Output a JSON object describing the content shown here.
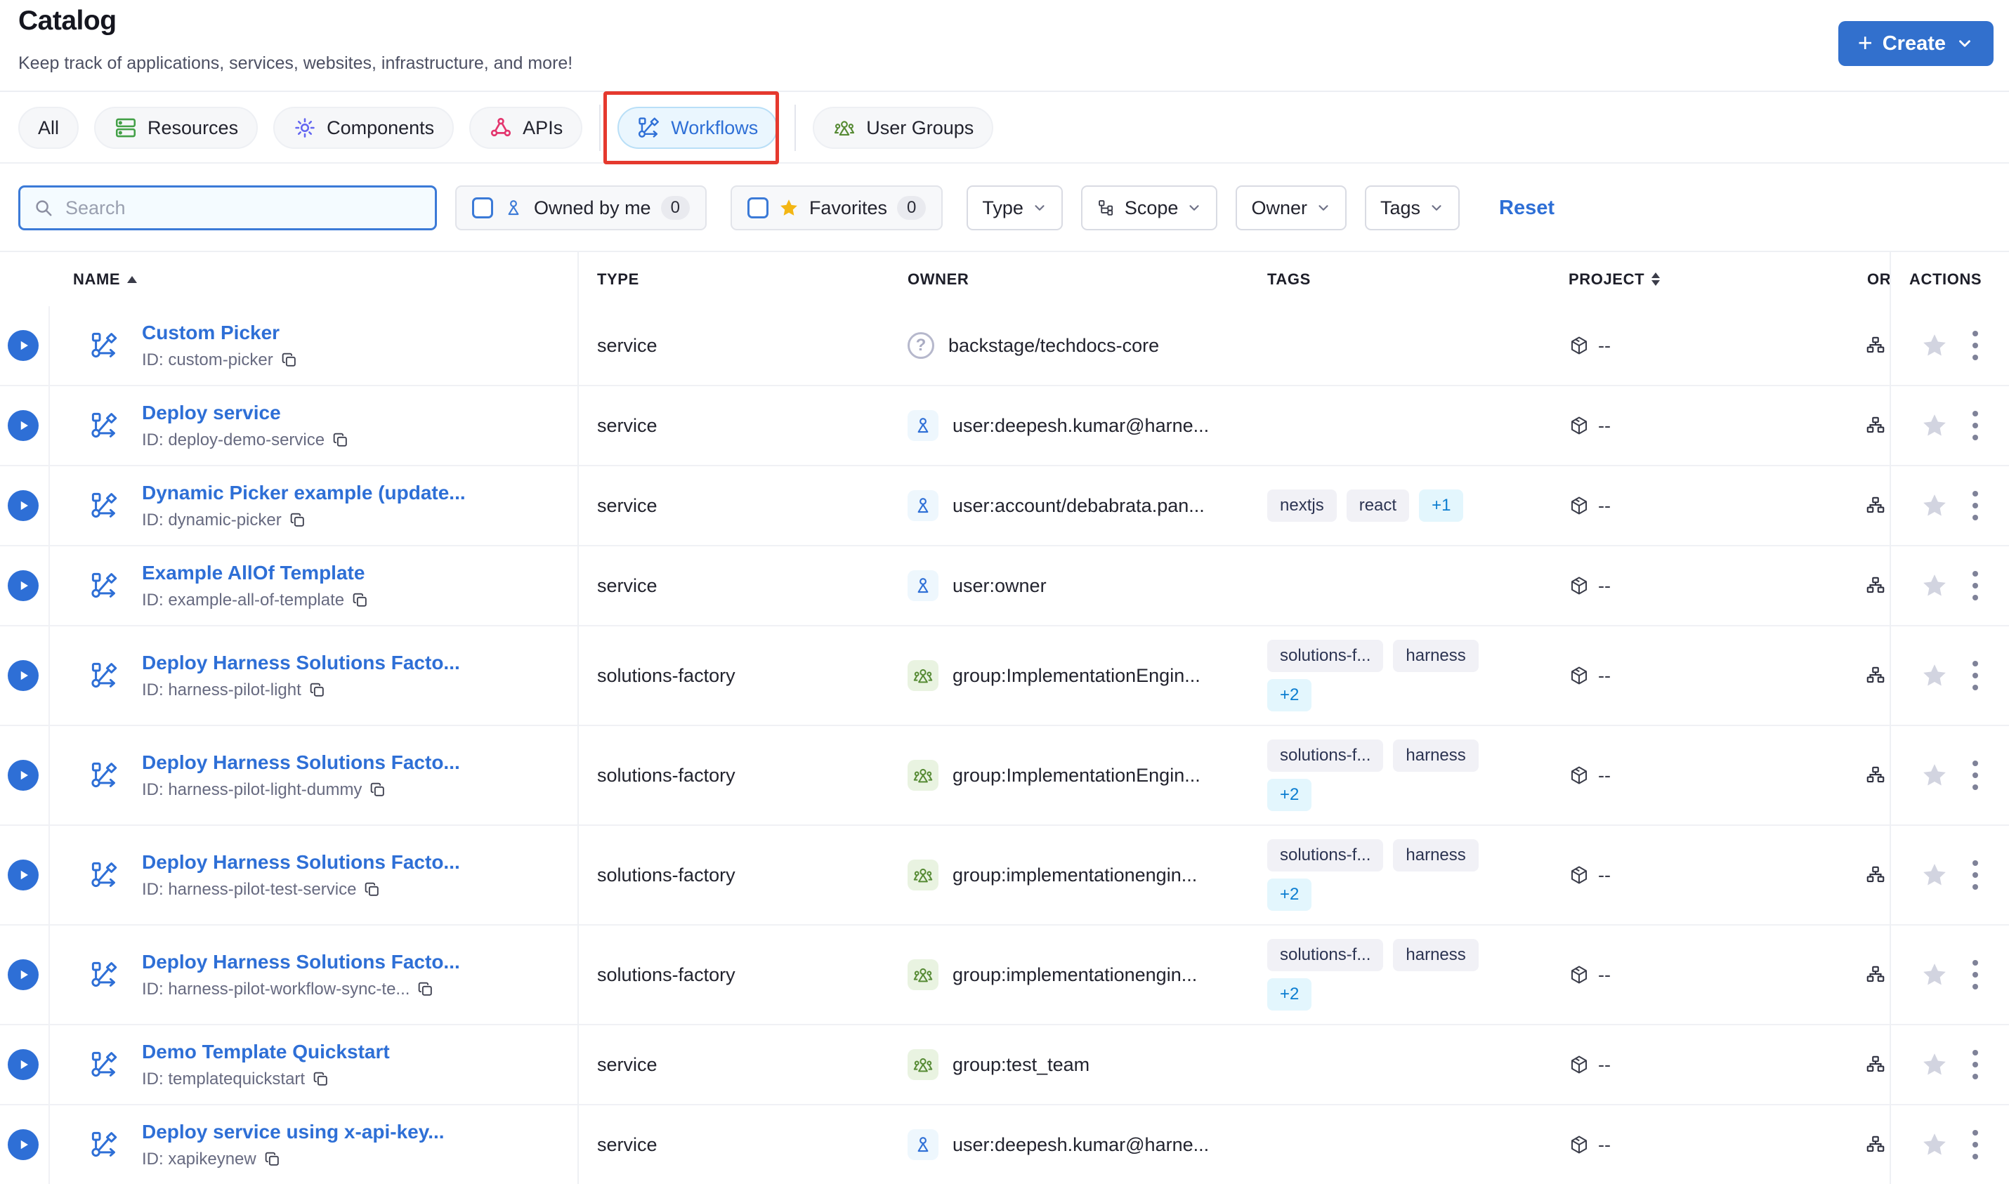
{
  "page": {
    "title": "Catalog",
    "subtitle": "Keep track of applications, services, websites, infrastructure, and more!"
  },
  "create_button": {
    "label": "Create",
    "plus": "+"
  },
  "tabs": {
    "items": [
      {
        "label": "All",
        "icon": null,
        "active": false,
        "annotated": false,
        "sep_before": false
      },
      {
        "label": "Resources",
        "icon": "resources-icon",
        "active": false,
        "annotated": false,
        "sep_before": false
      },
      {
        "label": "Components",
        "icon": "components-icon",
        "active": false,
        "annotated": false,
        "sep_before": false
      },
      {
        "label": "APIs",
        "icon": "apis-icon",
        "active": false,
        "annotated": false,
        "sep_before": false
      },
      {
        "label": "Workflows",
        "icon": "workflows-icon",
        "active": true,
        "annotated": true,
        "sep_before": true
      },
      {
        "label": "User Groups",
        "icon": "user-groups-icon",
        "active": false,
        "annotated": false,
        "sep_before": true
      }
    ],
    "annotation_color": "#e5392e"
  },
  "filters": {
    "search_placeholder": "Search",
    "toggles": [
      {
        "label": "Owned by me",
        "count": "0",
        "icon": "user-icon"
      },
      {
        "label": "Favorites",
        "count": "0",
        "icon": "favorite-star-icon"
      }
    ],
    "dropdowns": [
      {
        "label": "Type",
        "icon": null
      },
      {
        "label": "Scope",
        "icon": "scope-icon"
      },
      {
        "label": "Owner",
        "icon": null
      },
      {
        "label": "Tags",
        "icon": null
      }
    ],
    "reset_label": "Reset"
  },
  "table": {
    "headers": {
      "name": "NAME",
      "type": "TYPE",
      "owner": "OWNER",
      "tags": "TAGS",
      "project": "PROJECT",
      "org_clipped": "OR",
      "actions": "ACTIONS"
    },
    "rows": [
      {
        "name": "Custom Picker",
        "id": "ID: custom-picker",
        "type": "service",
        "owner": {
          "icon": "help",
          "text": "backstage/techdocs-core"
        },
        "tags": null,
        "project": "--"
      },
      {
        "name": "Deploy service",
        "id": "ID: deploy-demo-service",
        "type": "service",
        "owner": {
          "icon": "user",
          "text": "user:deepesh.kumar@harne..."
        },
        "tags": null,
        "project": "--"
      },
      {
        "name": "Dynamic Picker example (update...",
        "id": "ID: dynamic-picker",
        "type": "service",
        "owner": {
          "icon": "user",
          "text": "user:account/debabrata.pan..."
        },
        "tags": {
          "items": [
            "nextjs",
            "react"
          ],
          "more": "+1",
          "two_line": false
        },
        "project": "--"
      },
      {
        "name": "Example AllOf Template",
        "id": "ID: example-all-of-template",
        "type": "service",
        "owner": {
          "icon": "user",
          "text": "user:owner"
        },
        "tags": null,
        "project": "--"
      },
      {
        "name": "Deploy Harness Solutions Facto...",
        "id": "ID: harness-pilot-light",
        "type": "solutions-factory",
        "owner": {
          "icon": "group",
          "text": "group:ImplementationEngin..."
        },
        "tags": {
          "items": [
            "solutions-f...",
            "harness"
          ],
          "more": "+2",
          "two_line": true
        },
        "project": "--"
      },
      {
        "name": "Deploy Harness Solutions Facto...",
        "id": "ID: harness-pilot-light-dummy",
        "type": "solutions-factory",
        "owner": {
          "icon": "group",
          "text": "group:ImplementationEngin..."
        },
        "tags": {
          "items": [
            "solutions-f...",
            "harness"
          ],
          "more": "+2",
          "two_line": true
        },
        "project": "--"
      },
      {
        "name": "Deploy Harness Solutions Facto...",
        "id": "ID: harness-pilot-test-service",
        "type": "solutions-factory",
        "owner": {
          "icon": "group",
          "text": "group:implementationengin..."
        },
        "tags": {
          "items": [
            "solutions-f...",
            "harness"
          ],
          "more": "+2",
          "two_line": true
        },
        "project": "--"
      },
      {
        "name": "Deploy Harness Solutions Facto...",
        "id": "ID: harness-pilot-workflow-sync-te...",
        "type": "solutions-factory",
        "owner": {
          "icon": "group",
          "text": "group:implementationengin..."
        },
        "tags": {
          "items": [
            "solutions-f...",
            "harness"
          ],
          "more": "+2",
          "two_line": true
        },
        "project": "--"
      },
      {
        "name": "Demo Template Quickstart",
        "id": "ID: templatequickstart",
        "type": "service",
        "owner": {
          "icon": "group",
          "text": "group:test_team"
        },
        "tags": null,
        "project": "--"
      },
      {
        "name": "Deploy service using x-api-key...",
        "id": "ID: xapikeynew",
        "type": "service",
        "owner": {
          "icon": "user",
          "text": "user:deepesh.kumar@harne..."
        },
        "tags": null,
        "project": "--"
      }
    ]
  },
  "colors": {
    "primary_blue": "#2e6fd6",
    "create_button_bg": "#3270cd",
    "workflows_pill_bg": "#eaf6fe",
    "annotation_red": "#e5392e",
    "chip_bg": "#f1f1f6",
    "more_chip_bg": "#e3f6fd",
    "more_chip_text": "#0b7dd0",
    "group_green": "#568a34",
    "favorite_gold": "#f3b614"
  }
}
